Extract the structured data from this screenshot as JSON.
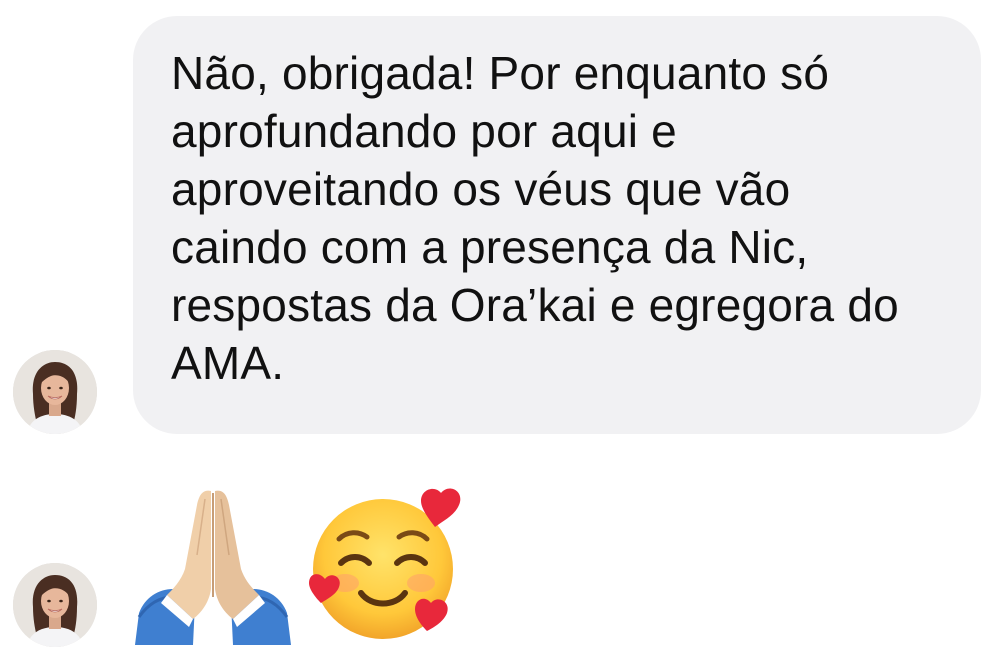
{
  "conversation": {
    "messages": [
      {
        "type": "text",
        "text": "Não, obrigada! Por enquanto só\naprofundando por aqui e\naproveitando os véus que vão\ncaindo com a presença da Nic,\nrespostas da Ora’kai e egregora do\nAMA."
      },
      {
        "type": "emoji",
        "emojis": [
          "folded-hands-icon",
          "smiling-face-with-hearts-icon"
        ]
      }
    ]
  },
  "colors": {
    "bubble": "#f1f1f3",
    "text": "#111111",
    "background": "#ffffff"
  }
}
